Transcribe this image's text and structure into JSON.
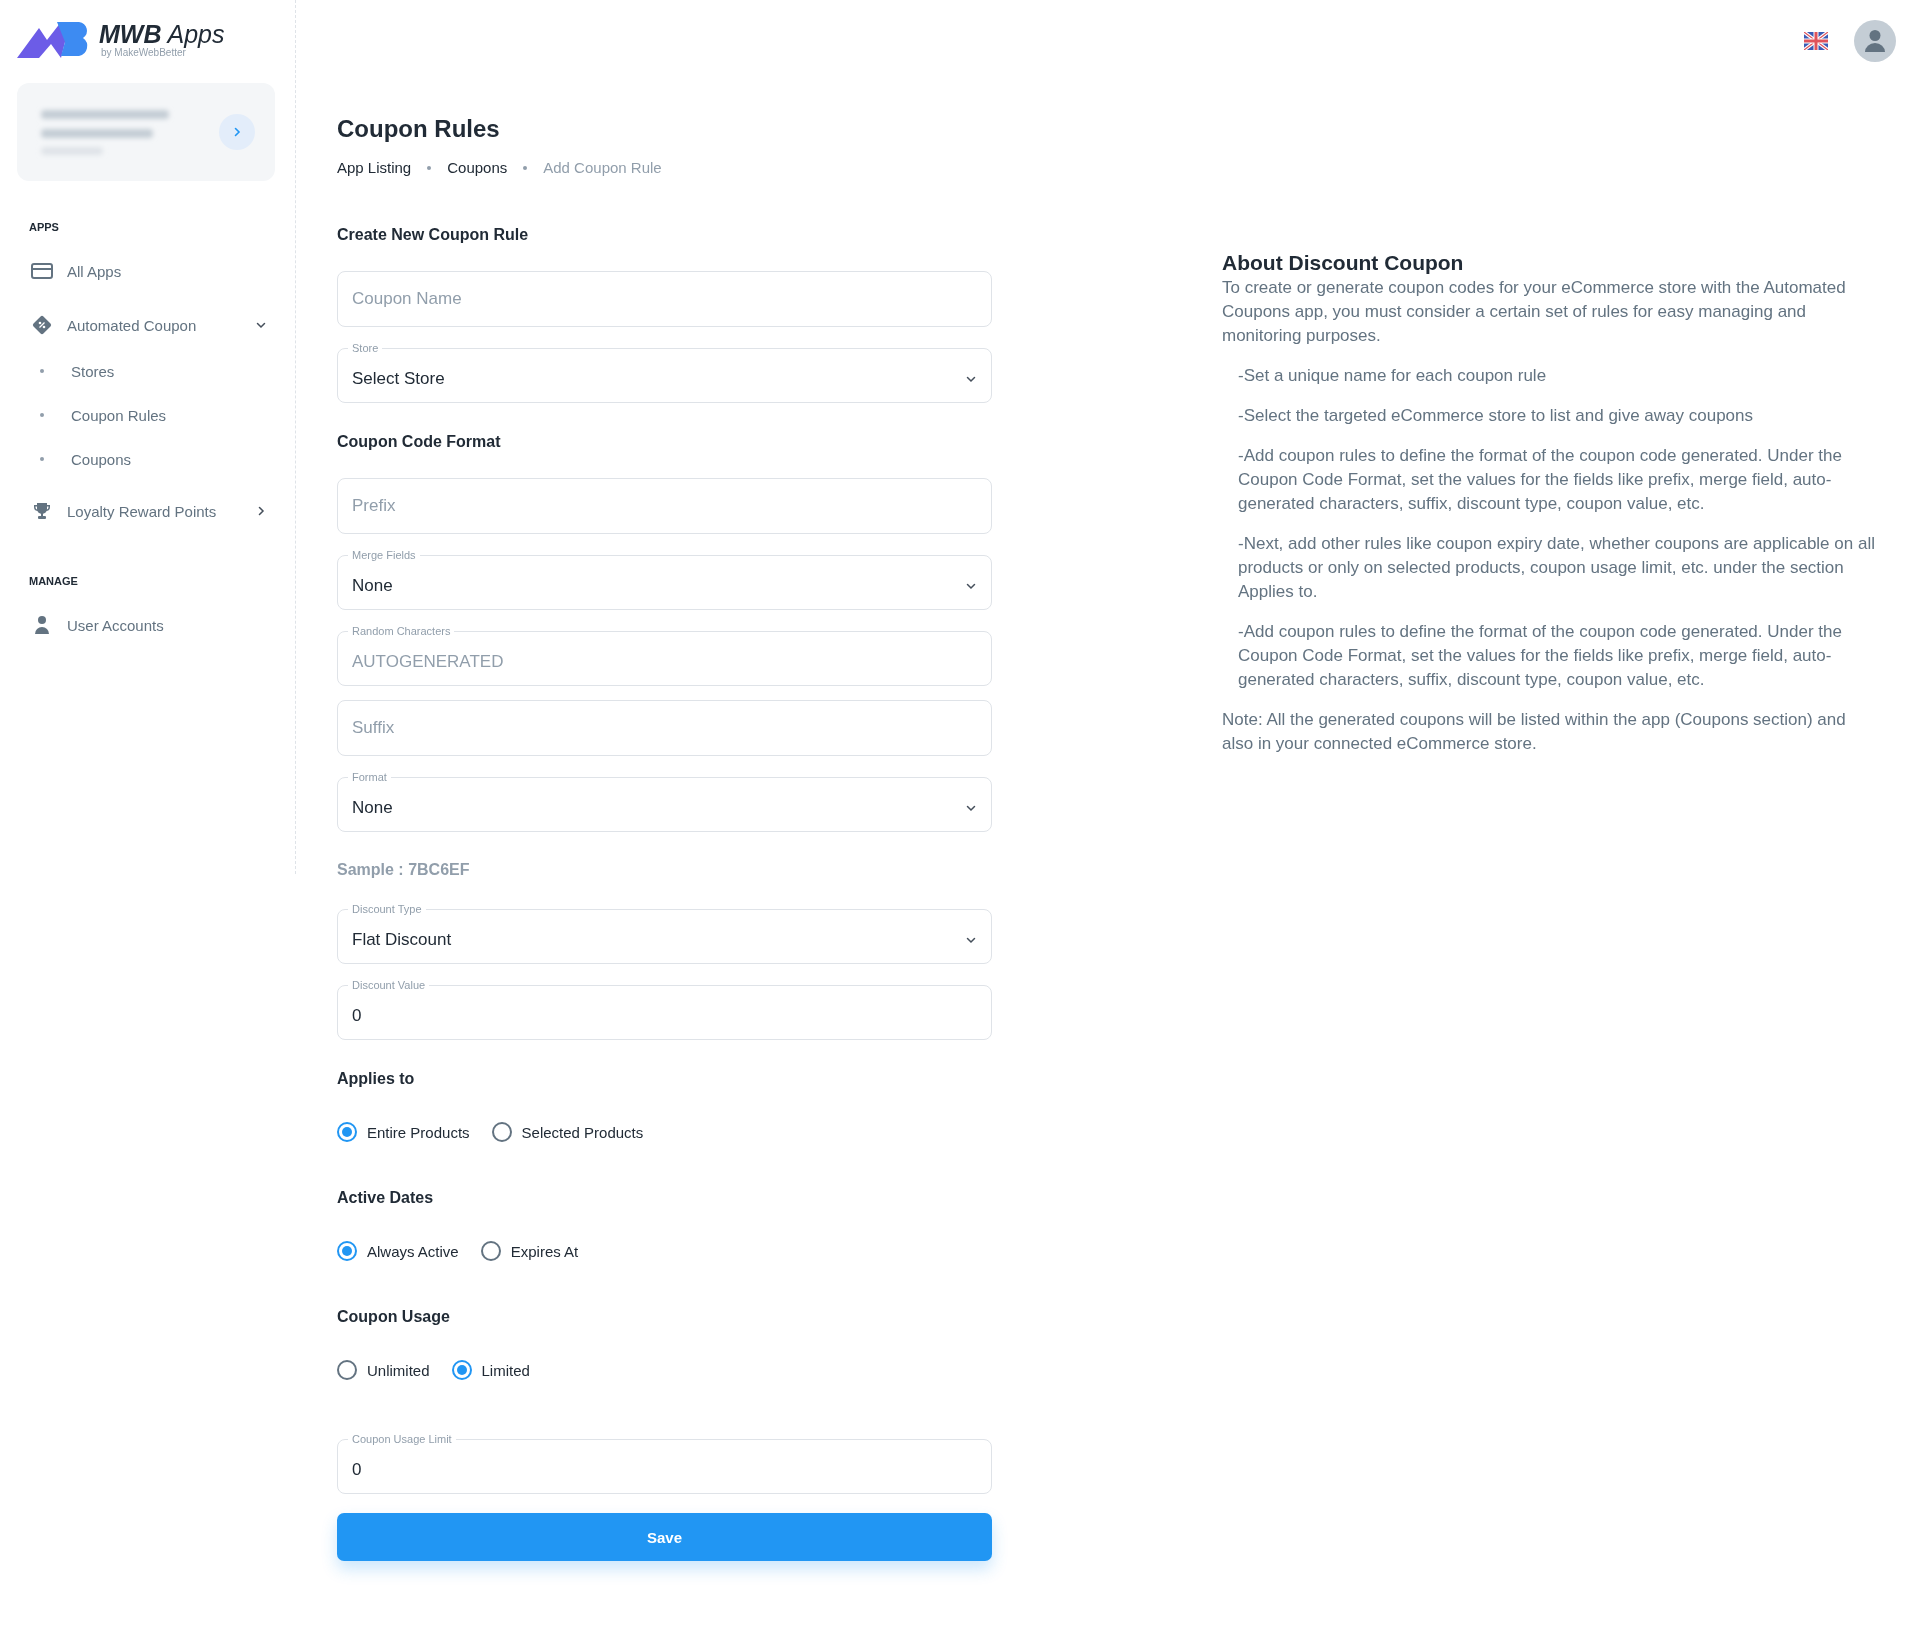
{
  "sidebar": {
    "logo": {
      "text": "**MWB** Apps",
      "tagline": "by MakeWebBetter"
    },
    "sections": [
      {
        "title": "APPS",
        "items": [
          {
            "kind": "card",
            "label": "All Apps"
          },
          {
            "kind": "coupon",
            "label": "Automated Coupon",
            "expanded": true,
            "children": [
              {
                "label": "Stores"
              },
              {
                "label": "Coupon Rules"
              },
              {
                "label": "Coupons"
              }
            ]
          },
          {
            "kind": "trophy",
            "label": "Loyalty Reward Points",
            "expanded": false
          }
        ]
      },
      {
        "title": "MANAGE",
        "items": [
          {
            "kind": "user",
            "label": "User Accounts"
          }
        ]
      }
    ]
  },
  "page": {
    "title": "Coupon Rules",
    "breadcrumb": [
      {
        "label": "App Listing",
        "current": false
      },
      {
        "label": "Coupons",
        "current": false
      },
      {
        "label": "Add Coupon Rule",
        "current": true
      }
    ]
  },
  "form": {
    "items": [
      {
        "kind": "heading",
        "text": "Create New Coupon Rule"
      },
      {
        "kind": "input",
        "placeholder": "Coupon Name"
      },
      {
        "kind": "select",
        "label": "Store",
        "value": "Select Store"
      },
      {
        "kind": "heading",
        "text": "Coupon Code Format"
      },
      {
        "kind": "input",
        "placeholder": "Prefix"
      },
      {
        "kind": "select",
        "label": "Merge Fields",
        "value": "None"
      },
      {
        "kind": "input",
        "label": "Random Characters",
        "placeholder": "AUTOGENERATED"
      },
      {
        "kind": "input",
        "placeholder": "Suffix"
      },
      {
        "kind": "select",
        "label": "Format",
        "value": "None"
      },
      {
        "kind": "sample",
        "text": "Sample : 7BC6EF"
      },
      {
        "kind": "select",
        "label": "Discount Type",
        "value": "Flat Discount"
      },
      {
        "kind": "input",
        "label": "Discount Value",
        "value": "0"
      },
      {
        "kind": "heading",
        "text": "Applies to"
      },
      {
        "kind": "radios",
        "options": [
          {
            "label": "Entire Products",
            "selected": true
          },
          {
            "label": "Selected Products",
            "selected": false
          }
        ]
      },
      {
        "kind": "heading",
        "text": "Active Dates"
      },
      {
        "kind": "radios",
        "options": [
          {
            "label": "Always Active",
            "selected": true
          },
          {
            "label": "Expires At",
            "selected": false
          }
        ]
      },
      {
        "kind": "heading",
        "text": "Coupon Usage"
      },
      {
        "kind": "radios",
        "options": [
          {
            "label": "Unlimited",
            "selected": false
          },
          {
            "label": "Limited",
            "selected": true
          }
        ]
      },
      {
        "kind": "input",
        "label": "Coupon Usage Limit",
        "value": "0"
      },
      {
        "kind": "button",
        "text": "Save"
      }
    ]
  },
  "about": {
    "title": "About Discount Coupon",
    "intro": "To create or generate coupon codes for your eCommerce store with the Automated Coupons app, you must consider a certain set of rules for easy managing and monitoring purposes.",
    "points": [
      "-Set a unique name for each coupon rule",
      "-Select the targeted eCommerce store to list and give away coupons",
      "-Add coupon rules to define the format of the coupon code generated. Under the Coupon Code Format, set the values for the fields like prefix, merge field, auto-generated characters, suffix, discount type, coupon value, etc.",
      "-Next, add other rules like coupon expiry date, whether coupons are applicable on all products or only on selected products, coupon usage limit, etc. under the section Applies to.",
      "-Add coupon rules to define the format of the coupon code generated. Under the Coupon Code Format, set the values for the fields like prefix, merge field, auto-generated characters, suffix, discount type, coupon value, etc."
    ],
    "note": "Note: All the generated coupons will be listed within the app (Coupons section) and also in your connected eCommerce store."
  }
}
